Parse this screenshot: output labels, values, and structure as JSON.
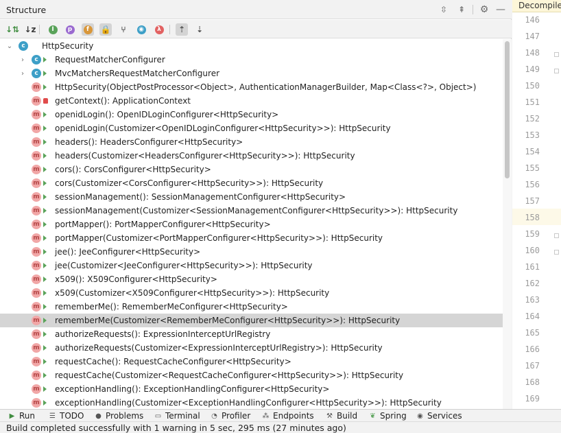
{
  "panel": {
    "title": "Structure"
  },
  "titlebar_icons": [
    "expand-all-icon",
    "collapse-all-icon",
    "gear-icon",
    "minimize-icon"
  ],
  "toolbar": {
    "tools": [
      {
        "name": "sort-by-visibility-icon",
        "glyph": "↓⇅",
        "color": "#3f8c3f"
      },
      {
        "name": "sort-alphabetically-icon",
        "glyph": "↓z",
        "color": "#3b3b3b"
      },
      {
        "name": "show-inherited-icon",
        "glyph": "I",
        "color": "#5aa35a"
      },
      {
        "name": "show-properties-icon",
        "glyph": "p",
        "color": "#9a6ad0"
      },
      {
        "name": "show-fields-icon",
        "glyph": "f",
        "color": "#d9973a"
      },
      {
        "name": "show-non-public-icon",
        "glyph": "🔒",
        "color": "#e4873a"
      },
      {
        "name": "show-lambdas-tree-icon",
        "glyph": "⑂",
        "color": "#555555"
      },
      {
        "name": "show-anonymous-icon",
        "glyph": "◉",
        "color": "#3d9fc7"
      },
      {
        "name": "show-lambdas-icon",
        "glyph": "λ",
        "color": "#e26262"
      },
      {
        "name": "autoscroll-to-source-icon",
        "glyph": "⇡",
        "color": "#555555"
      },
      {
        "name": "autoscroll-from-source-icon",
        "glyph": "⇣",
        "color": "#555555"
      }
    ]
  },
  "tree": {
    "root": {
      "label": "HttpSecurity",
      "icon": "C"
    },
    "classes": [
      {
        "label": "RequestMatcherConfigurer",
        "icon": "C"
      },
      {
        "label": "MvcMatchersRequestMatcherConfigurer",
        "icon": "C"
      }
    ],
    "methods": [
      {
        "label": "HttpSecurity(ObjectPostProcessor<Object>, AuthenticationManagerBuilder, Map<Class<?>, Object>)",
        "visibility": "public"
      },
      {
        "label": "getContext(): ApplicationContext",
        "visibility": "private"
      },
      {
        "label": "openidLogin(): OpenIDLoginConfigurer<HttpSecurity>",
        "visibility": "public"
      },
      {
        "label": "openidLogin(Customizer<OpenIDLoginConfigurer<HttpSecurity>>): HttpSecurity",
        "visibility": "public"
      },
      {
        "label": "headers(): HeadersConfigurer<HttpSecurity>",
        "visibility": "public"
      },
      {
        "label": "headers(Customizer<HeadersConfigurer<HttpSecurity>>): HttpSecurity",
        "visibility": "public"
      },
      {
        "label": "cors(): CorsConfigurer<HttpSecurity>",
        "visibility": "public"
      },
      {
        "label": "cors(Customizer<CorsConfigurer<HttpSecurity>>): HttpSecurity",
        "visibility": "public"
      },
      {
        "label": "sessionManagement(): SessionManagementConfigurer<HttpSecurity>",
        "visibility": "public"
      },
      {
        "label": "sessionManagement(Customizer<SessionManagementConfigurer<HttpSecurity>>): HttpSecurity",
        "visibility": "public"
      },
      {
        "label": "portMapper(): PortMapperConfigurer<HttpSecurity>",
        "visibility": "public"
      },
      {
        "label": "portMapper(Customizer<PortMapperConfigurer<HttpSecurity>>): HttpSecurity",
        "visibility": "public"
      },
      {
        "label": "jee(): JeeConfigurer<HttpSecurity>",
        "visibility": "public"
      },
      {
        "label": "jee(Customizer<JeeConfigurer<HttpSecurity>>): HttpSecurity",
        "visibility": "public"
      },
      {
        "label": "x509(): X509Configurer<HttpSecurity>",
        "visibility": "public"
      },
      {
        "label": "x509(Customizer<X509Configurer<HttpSecurity>>): HttpSecurity",
        "visibility": "public"
      },
      {
        "label": "rememberMe(): RememberMeConfigurer<HttpSecurity>",
        "visibility": "public"
      },
      {
        "label": "rememberMe(Customizer<RememberMeConfigurer<HttpSecurity>>): HttpSecurity",
        "visibility": "public",
        "selected": true
      },
      {
        "label": "authorizeRequests(): ExpressionInterceptUrlRegistry",
        "visibility": "public"
      },
      {
        "label": "authorizeRequests(Customizer<ExpressionInterceptUrlRegistry>): HttpSecurity",
        "visibility": "public"
      },
      {
        "label": "requestCache(): RequestCacheConfigurer<HttpSecurity>",
        "visibility": "public"
      },
      {
        "label": "requestCache(Customizer<RequestCacheConfigurer<HttpSecurity>>): HttpSecurity",
        "visibility": "public"
      },
      {
        "label": "exceptionHandling(): ExceptionHandlingConfigurer<HttpSecurity>",
        "visibility": "public"
      },
      {
        "label": "exceptionHandling(Customizer<ExceptionHandlingConfigurer<HttpSecurity>>): HttpSecurity",
        "visibility": "public"
      }
    ]
  },
  "editor": {
    "tab_label": "Decompile",
    "line_numbers": [
      "146",
      "147",
      "148",
      "149",
      "150",
      "151",
      "152",
      "153",
      "154",
      "155",
      "156",
      "157",
      "158",
      "159",
      "160",
      "161",
      "162",
      "163",
      "164",
      "165",
      "166",
      "167",
      "168",
      "169"
    ],
    "current_line": "158"
  },
  "tool_windows": [
    {
      "label": "Run",
      "icon": "run-icon"
    },
    {
      "label": "TODO",
      "icon": "todo-icon"
    },
    {
      "label": "Problems",
      "icon": "problems-icon"
    },
    {
      "label": "Terminal",
      "icon": "terminal-icon"
    },
    {
      "label": "Profiler",
      "icon": "profiler-icon"
    },
    {
      "label": "Endpoints",
      "icon": "endpoints-icon"
    },
    {
      "label": "Build",
      "icon": "build-icon"
    },
    {
      "label": "Spring",
      "icon": "spring-icon"
    },
    {
      "label": "Services",
      "icon": "services-icon"
    }
  ],
  "status": {
    "text": "Build completed successfully with 1 warning in 5 sec, 295 ms (27 minutes ago)"
  },
  "colors": {
    "class_icon": "#3d9fc7",
    "method_icon_bg": "#f1a7a7",
    "method_icon_fg": "#b44545",
    "public_marker": "#5aa35a",
    "private_marker": "#e04b4b",
    "selection": "#d5d5d5",
    "current_line": "#fdf9e8"
  }
}
